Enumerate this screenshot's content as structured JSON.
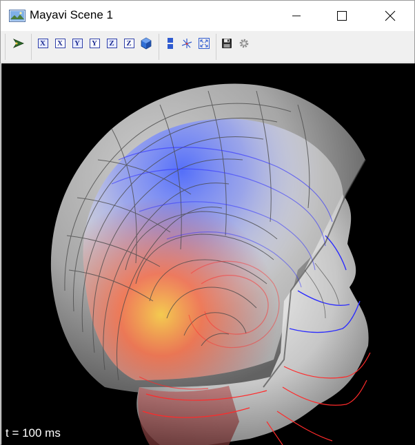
{
  "window": {
    "title": "Mayavi Scene 1"
  },
  "title_bar_buttons": {
    "minimize_icon": "minimize-icon",
    "maximize_icon": "maximize-icon",
    "close_icon": "close-icon"
  },
  "toolbar": {
    "buttons": [
      {
        "name": "mayavi-pipeline-icon"
      },
      {
        "label": "X",
        "name": "view-x-positive-button"
      },
      {
        "label": "X",
        "name": "view-x-negative-button"
      },
      {
        "label": "Y",
        "name": "view-y-positive-button"
      },
      {
        "label": "Y",
        "name": "view-y-negative-button"
      },
      {
        "label": "Z",
        "name": "view-z-positive-button"
      },
      {
        "label": "Z",
        "name": "view-z-negative-button"
      },
      {
        "name": "isometric-view-icon"
      },
      {
        "name": "toggle-parallel-projection-icon"
      },
      {
        "name": "toggle-axes-indicator-icon"
      },
      {
        "name": "full-screen-icon"
      },
      {
        "name": "save-icon"
      },
      {
        "name": "settings-icon"
      }
    ]
  },
  "scene": {
    "background": "#000000",
    "time_label": "t = 100 ms",
    "colors": {
      "negative_contour": "#2b2bff",
      "positive_contour": "#ff2a2a",
      "head_surface": "#bdbdbd",
      "helmet_surface": "#9a9a9a"
    }
  }
}
